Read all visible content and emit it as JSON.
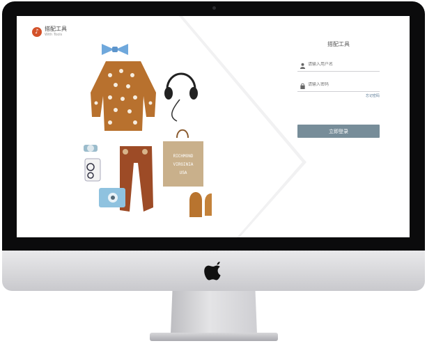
{
  "app": {
    "logo_title": "搭配工具",
    "logo_subtitle": "With Tools"
  },
  "login": {
    "title": "搭配工具",
    "username_placeholder": "请输入用户名",
    "password_placeholder": "请输入密码",
    "forgot_link": "忘记密码",
    "submit_label": "立即登录"
  },
  "icons": {
    "logo": "circle-logo-icon",
    "user": "user-icon",
    "lock": "lock-icon",
    "apple": "apple-icon"
  },
  "colors": {
    "bezel": "#0b0b0c",
    "logo_accent": "#d3522a",
    "button": "#778d99",
    "link": "#5b7a96",
    "sweater": "#b8712e",
    "tights": "#9d4b26",
    "bow_tie": "#6fa8dc"
  },
  "illustration": {
    "tote_lines": [
      "RICHMOND",
      "VIRGINIA",
      "USA"
    ]
  }
}
